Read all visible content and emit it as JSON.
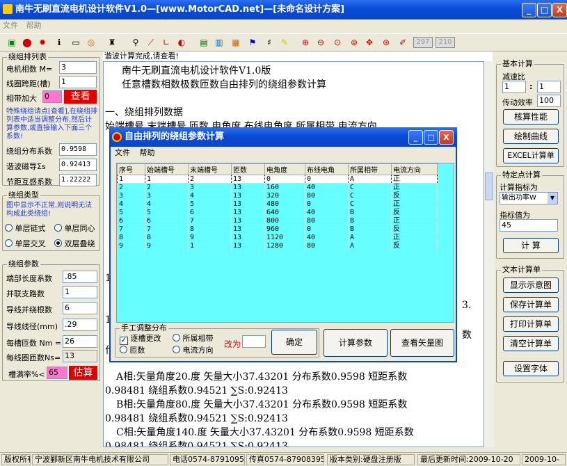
{
  "app": {
    "title": "南牛无刷直流电机设计软件V1.0—[www.MotorCAD.net]—[未命名设计方案]",
    "window_buttons": {
      "minimize": "_",
      "maximize": "□",
      "close": "X"
    }
  },
  "menu": [
    "文件",
    "帮助"
  ],
  "toolbar": {
    "field1": "297",
    "field2": "210"
  },
  "left": {
    "winding_table": {
      "title": "绕组排列表",
      "phases_label": "电机相数 M=",
      "phases_value": "3",
      "pitch_label": "线圈跨距(槽)",
      "pitch_value": "1",
      "band_label": "相带加大",
      "band_value": "0",
      "view_btn": "查看",
      "note": "特殊绕组请点[查看],在绕组排列表中适当调整分布,然后计算参数,或直接输入下面三个系数!",
      "dist_label": "绕组分布系数",
      "dist_value": "0.9598",
      "harm_label": "谐波磁导Σs",
      "harm_value": "0.92413",
      "mut_label": "节距互感系数",
      "mut_value": "1.22222"
    },
    "winding_type": {
      "title": "绕组类型",
      "note": "图中显示不正常,则说明无法构成此类绕组!",
      "opt1": "单层链式",
      "opt2": "单层同心",
      "opt3": "单层交叉",
      "opt4": "双层叠绕"
    },
    "winding_params": {
      "title": "绕组参数",
      "end_label": "端部长度系数",
      "end_value": ".85",
      "parallel_label": "并联支路数",
      "parallel_value": "1",
      "wires_label": "导线并绕根数",
      "wires_value": "6",
      "dia_label": "导线线径(mm)",
      "dia_value": ".29",
      "turns_label": "每槽匝数 Nm =",
      "turns_value": "26",
      "coil_label": "每线圈匝数Ns=",
      "coil_value": "13",
      "fill_label": "槽满率%<",
      "fill_value": "65",
      "estimate_btn": "估算"
    }
  },
  "status_strip": "谐波计算完成,请查看!",
  "doc": {
    "line1": "南牛无刷直流电机设计软件V1.0版",
    "line2": "任意槽数相数极数匝数自由排列的绕组参数计算",
    "section1": "一、绕组排列数据",
    "header_partial": "始端槽号  末端槽号  匝数    电角度    布线电角度    所属相带    电流方向",
    "a1": "A相:矢量角度20.度   矢量大小37.43201   分布系数0.9598   短距系数",
    "a2": "0.98481   绕组系数0.94521   ∑S:0.92413",
    "b1": "B相:矢量角度80.度   矢量大小37.43201   分布系数0.9598   短距系数",
    "b2": "0.98481   绕组系数0.94521   ∑S:0.92413",
    "c1": "C相:矢量角度140.度   矢量大小37.43201   分布系数0.9598   短距系数",
    "c2": "0.98481   绕组系数0.94521   ∑S:0.92413",
    "frag1": "3.",
    "frag2": "数",
    "frag3": "1",
    "frag4": "1",
    "frag5": "作"
  },
  "dialog": {
    "title": "自由排列的绕组参数计算",
    "menu": [
      "文件",
      "帮助"
    ],
    "columns": [
      "序号",
      "始端槽号",
      "末端槽号",
      "匝数",
      "电角度",
      "布线电角",
      "所属相带",
      "电流方向"
    ],
    "rows": [
      [
        "1",
        "1",
        "2",
        "13",
        "0",
        "0",
        "A",
        "正"
      ],
      [
        "2",
        "2",
        "3",
        "13",
        "160",
        "40",
        "C",
        "正"
      ],
      [
        "3",
        "3",
        "4",
        "13",
        "320",
        "80",
        "C",
        "反"
      ],
      [
        "4",
        "4",
        "5",
        "13",
        "480",
        "0",
        "C",
        "正"
      ],
      [
        "5",
        "5",
        "6",
        "13",
        "640",
        "40",
        "B",
        "反"
      ],
      [
        "6",
        "6",
        "7",
        "13",
        "800",
        "80",
        "B",
        "正"
      ],
      [
        "7",
        "7",
        "8",
        "13",
        "960",
        "0",
        "B",
        "反"
      ],
      [
        "8",
        "8",
        "9",
        "13",
        "1120",
        "40",
        "A",
        "正"
      ],
      [
        "9",
        "9",
        "1",
        "13",
        "1280",
        "80",
        "A",
        "反"
      ]
    ],
    "manual_title": "手工调整分布",
    "chk_label": "逐槽更改",
    "r_phase": "所属相带",
    "r_turns": "匝数",
    "r_current": "电流方向",
    "change_label": "改为",
    "change_value": "",
    "ok_btn": "确定",
    "calc_btn": "计算参数",
    "vector_btn": "查看矢量图"
  },
  "right": {
    "basic": {
      "title": "基本计算",
      "ratio_label": "减速比",
      "ratio_a": "1",
      "ratio_colon": ":",
      "ratio_b": "1",
      "eff_label": "传动效率",
      "eff_value": "100",
      "btn1": "核算性能",
      "btn2": "绘制曲线",
      "btn3": "EXCEL计算单"
    },
    "special": {
      "title": "特定点计算",
      "target_label": "计算指标为",
      "target_value": "输出功率W",
      "val_label": "指标值为",
      "val_value": "45",
      "calc_btn": "计 算"
    },
    "text": {
      "title": "文本计算单",
      "btn1": "显示示意图",
      "btn2": "保存计算单",
      "btn3": "打印计算单",
      "btn4": "清空计算单",
      "btn5": "设置字体"
    }
  },
  "statusbar": {
    "c1": "版权所有",
    "c2": "宁波鄞新区南牛电机技术有限公司",
    "c3": "电话0574-87910951",
    "c4": "传真0574-87908395",
    "c5": "版本类别:硬盘注册版",
    "c6": "最后更新时间:2009-10-20",
    "c7": "2009-10-"
  }
}
